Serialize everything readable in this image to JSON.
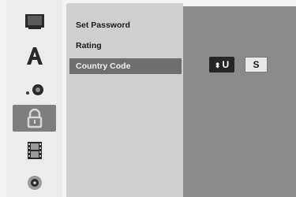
{
  "sidebar": {
    "icons": [
      {
        "name": "disc-icon"
      },
      {
        "name": "language-icon"
      },
      {
        "name": "audio-icon"
      },
      {
        "name": "lock-icon",
        "selected": true
      },
      {
        "name": "video-icon"
      },
      {
        "name": "disc-playback-icon"
      }
    ]
  },
  "menu": {
    "items": [
      {
        "label": "Set Password"
      },
      {
        "label": "Rating"
      },
      {
        "label": "Country Code",
        "selected": true
      }
    ]
  },
  "country_code": {
    "first_letter": "U",
    "second_letter": "S",
    "arrows": "⬍"
  },
  "colors": {
    "panel_bg": "#cfcfcf",
    "option_bg": "#8a8a8a",
    "selected_bg": "#6e6e6e"
  }
}
